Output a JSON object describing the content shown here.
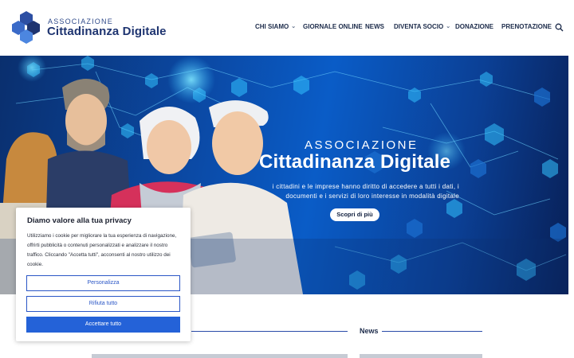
{
  "header": {
    "brand_top": "ASSOCIAZIONE",
    "brand_main": "Cittadinanza Digitale",
    "nav": [
      {
        "label": "CHI SIAMO",
        "dropdown": true
      },
      {
        "label": "GIORNALE ONLINE",
        "dropdown": false
      },
      {
        "label": "NEWS",
        "dropdown": false
      },
      {
        "label": "DIVENTA SOCIO",
        "dropdown": true
      },
      {
        "label": "DONAZIONE",
        "dropdown": false
      },
      {
        "label": "PRENOTAZIONE",
        "dropdown": false
      }
    ],
    "search_icon": "search-icon",
    "chevron_icon": "chevron-down-icon"
  },
  "hero": {
    "kicker": "ASSOCIAZIONE",
    "title": "Cittadinanza Digitale",
    "subtitle": "i cittadini e le imprese hanno diritto di accedere a tutti i dati, i documenti e i servizi di loro interesse in modalità digitale",
    "button": "Scopri di più"
  },
  "sections": {
    "news_title": "News"
  },
  "cookie": {
    "title": "Diamo valore alla tua privacy",
    "text": "Utilizziamo i cookie per migliorare la tua esperienza di navigazione, offrirti pubblicità o contenuti personalizzati e analizzare il nostro traffico. Cliccando \"Accetta tutti\", acconsenti al nostro utilizzo dei cookie.",
    "customize": "Personalizza",
    "reject": "Rifiuta tutto",
    "accept": "Accettare tutto"
  },
  "colors": {
    "brand": "#1e3470",
    "accent": "#2462d8",
    "hero_blue": "#0b4aa6"
  }
}
